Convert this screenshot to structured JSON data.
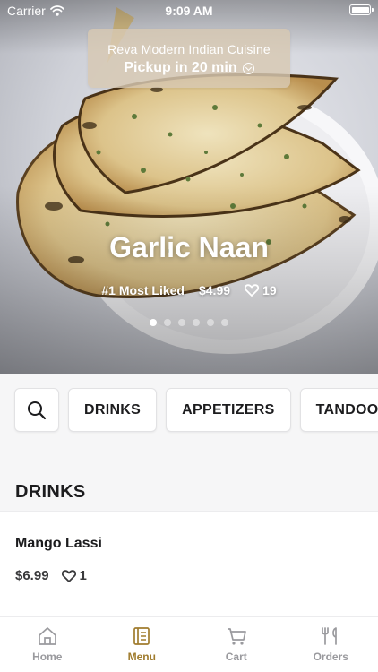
{
  "status_bar": {
    "carrier": "Carrier",
    "time": "9:09 AM"
  },
  "restaurant": {
    "name": "Reva Modern Indian Cuisine",
    "pickup": "Pickup in 20 min"
  },
  "featured": {
    "title": "Garlic Naan",
    "badge": "#1 Most Liked",
    "price": "$4.99",
    "likes": "19",
    "carousel_count": 6,
    "carousel_active": 0
  },
  "categories": [
    "DRINKS",
    "APPETIZERS",
    "TANDOOR"
  ],
  "section": {
    "title": "DRINKS"
  },
  "items": [
    {
      "name": "Mango Lassi",
      "price": "$6.99",
      "likes": "1"
    }
  ],
  "tabs": [
    {
      "label": "Home",
      "icon": "home-icon",
      "active": false
    },
    {
      "label": "Menu",
      "icon": "menu-icon",
      "active": true
    },
    {
      "label": "Cart",
      "icon": "cart-icon",
      "active": false
    },
    {
      "label": "Orders",
      "icon": "orders-icon",
      "active": false
    }
  ],
  "colors": {
    "accent": "#a07c2e",
    "inactive": "#9a9a9e",
    "pill": "#d7c8b2"
  }
}
